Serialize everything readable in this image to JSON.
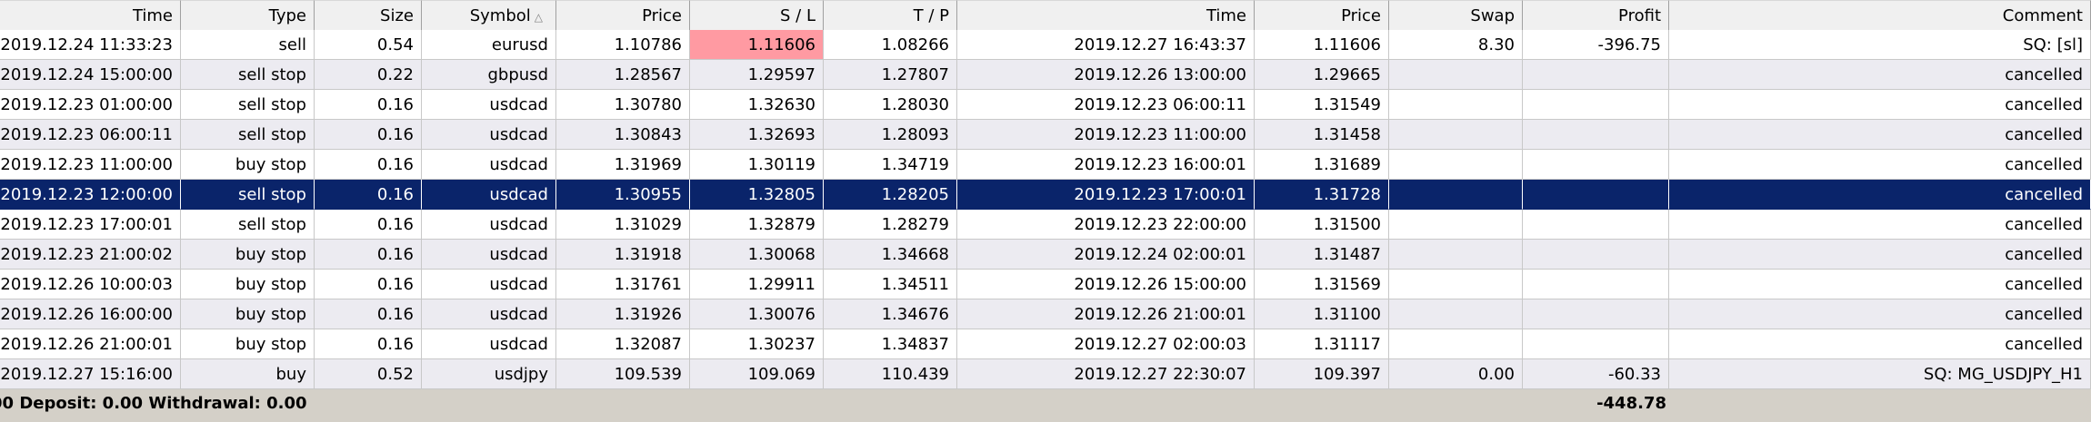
{
  "columns": [
    "Time",
    "Type",
    "Size",
    "Symbol",
    "Price",
    "S / L",
    "T / P",
    "Time",
    "Price",
    "Swap",
    "Profit",
    "Comment"
  ],
  "sort_indicator": "triangle-up-icon",
  "highlight_color": "#ff9aa2",
  "selection_color": "#0a246a",
  "rows": [
    [
      "2019.12.24 11:33:23",
      "sell",
      "0.54",
      "eurusd",
      "1.10786",
      "1.11606",
      "1.08266",
      "2019.12.27 16:43:37",
      "1.11606",
      "8.30",
      "-396.75",
      "SQ: [sl]"
    ],
    [
      "2019.12.24 15:00:00",
      "sell stop",
      "0.22",
      "gbpusd",
      "1.28567",
      "1.29597",
      "1.27807",
      "2019.12.26 13:00:00",
      "1.29665",
      "",
      "",
      "cancelled"
    ],
    [
      "2019.12.23 01:00:00",
      "sell stop",
      "0.16",
      "usdcad",
      "1.30780",
      "1.32630",
      "1.28030",
      "2019.12.23 06:00:11",
      "1.31549",
      "",
      "",
      "cancelled"
    ],
    [
      "2019.12.23 06:00:11",
      "sell stop",
      "0.16",
      "usdcad",
      "1.30843",
      "1.32693",
      "1.28093",
      "2019.12.23 11:00:00",
      "1.31458",
      "",
      "",
      "cancelled"
    ],
    [
      "2019.12.23 11:00:00",
      "buy stop",
      "0.16",
      "usdcad",
      "1.31969",
      "1.30119",
      "1.34719",
      "2019.12.23 16:00:01",
      "1.31689",
      "",
      "",
      "cancelled"
    ],
    [
      "2019.12.23 12:00:00",
      "sell stop",
      "0.16",
      "usdcad",
      "1.30955",
      "1.32805",
      "1.28205",
      "2019.12.23 17:00:01",
      "1.31728",
      "",
      "",
      "cancelled"
    ],
    [
      "2019.12.23 17:00:01",
      "sell stop",
      "0.16",
      "usdcad",
      "1.31029",
      "1.32879",
      "1.28279",
      "2019.12.23 22:00:00",
      "1.31500",
      "",
      "",
      "cancelled"
    ],
    [
      "2019.12.23 21:00:02",
      "buy stop",
      "0.16",
      "usdcad",
      "1.31918",
      "1.30068",
      "1.34668",
      "2019.12.24 02:00:01",
      "1.31487",
      "",
      "",
      "cancelled"
    ],
    [
      "2019.12.26 10:00:03",
      "buy stop",
      "0.16",
      "usdcad",
      "1.31761",
      "1.29911",
      "1.34511",
      "2019.12.26 15:00:00",
      "1.31569",
      "",
      "",
      "cancelled"
    ],
    [
      "2019.12.26 16:00:00",
      "buy stop",
      "0.16",
      "usdcad",
      "1.31926",
      "1.30076",
      "1.34676",
      "2019.12.26 21:00:01",
      "1.31100",
      "",
      "",
      "cancelled"
    ],
    [
      "2019.12.26 21:00:01",
      "buy stop",
      "0.16",
      "usdcad",
      "1.32087",
      "1.30237",
      "1.34837",
      "2019.12.27 02:00:03",
      "1.31117",
      "",
      "",
      "cancelled"
    ],
    [
      "2019.12.27 15:16:00",
      "buy",
      "0.52",
      "usdjpy",
      "109.539",
      "109.069",
      "110.439",
      "2019.12.27 22:30:07",
      "109.397",
      "0.00",
      "-60.33",
      "SQ: MG_USDJPY_H1"
    ]
  ],
  "selected_row": 5,
  "highlighted_cell": {
    "row": 0,
    "col": 5
  },
  "footer": {
    "summary": "00  Deposit: 0.00  Withdrawal: 0.00",
    "total_profit": "-448.78"
  }
}
